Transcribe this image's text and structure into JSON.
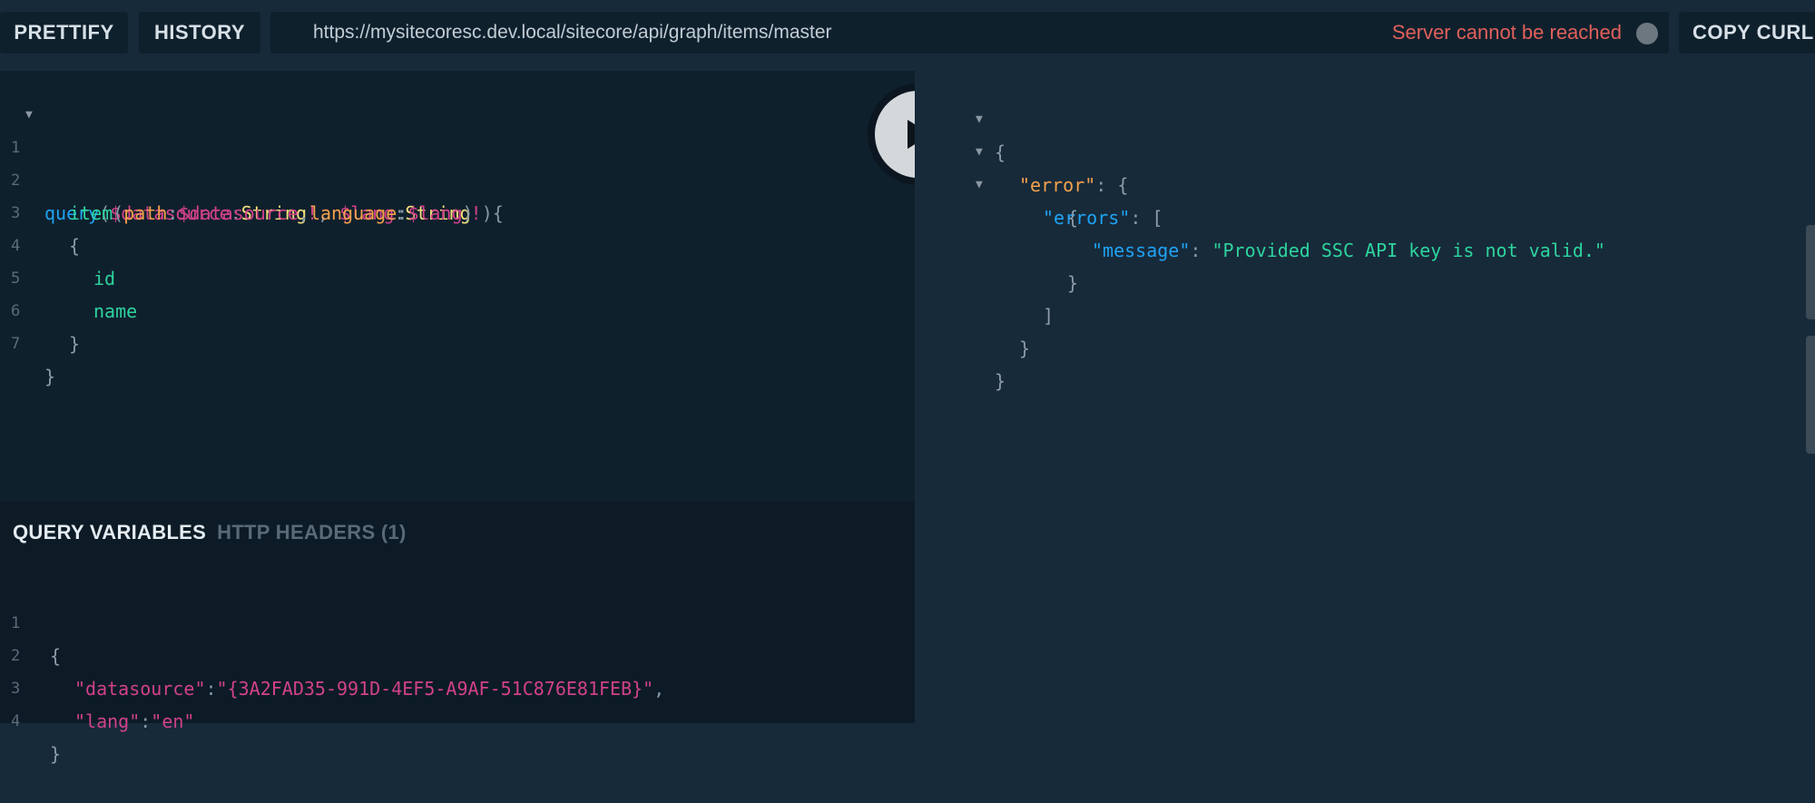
{
  "toolbar": {
    "prettify_label": "PRETTIFY",
    "history_label": "HISTORY",
    "url": "https://mysitecoresc.dev.local/sitecore/api/graph/items/master",
    "status_text": "Server cannot be reached",
    "copy_curl_label": "COPY CURL"
  },
  "query_editor": {
    "line_numbers": [
      "1",
      "2",
      "3",
      "4",
      "5",
      "6",
      "7"
    ],
    "l1": {
      "kw": "query",
      "p1": "(",
      "v1": "$datasource",
      "c1": ":",
      "t1": "String",
      "b1": "!",
      "sep": ", ",
      "v2": "$lang",
      "c2": ":",
      "t2": "String",
      "b2": "!",
      "end": "){"
    },
    "l2": {
      "fn": "item",
      "p1": "(",
      "a1": "path",
      "c1": ":",
      "v1": "$datasource",
      "sep": ",",
      "a2": "language",
      "c2": ":",
      "v2": "$lang",
      "end": ")"
    },
    "l3": "{",
    "l4": "id",
    "l5": "name",
    "l6": "}",
    "l7": "}"
  },
  "variables_panel": {
    "tab_query_variables": "QUERY VARIABLES",
    "tab_http_headers": "HTTP HEADERS (1)",
    "line_numbers": [
      "1",
      "2",
      "3",
      "4"
    ],
    "l1": "{",
    "l2": {
      "key": "\"datasource\"",
      "colon": ":",
      "value": "\"{3A2FAD35-991D-4EF5-A9AF-51C876E81FEB}\"",
      "comma": ","
    },
    "l3": {
      "key": "\"lang\"",
      "colon": ":",
      "value": "\"en\""
    },
    "l4": "}"
  },
  "result": {
    "open": "{",
    "error_key": "\"error\"",
    "errors_key": "\"errors\"",
    "bracket_open": "[",
    "obj_open": "{",
    "message_key": "\"message\"",
    "message_value": "\"Provided SSC API key is not valid.\"",
    "obj_close": "}",
    "bracket_close": "]",
    "inner_close": "}",
    "close": "}"
  },
  "colors": {
    "background": "#172a3a",
    "editor_background": "#0f202d",
    "status_error": "#e0605b",
    "keyword": "#1fa3f4",
    "variable": "#d1418a",
    "type": "#f3e17b",
    "field": "#2ed49e"
  },
  "icons": {
    "run": "play-icon",
    "status": "status-dot-icon",
    "fold": "fold-arrow-icon"
  }
}
